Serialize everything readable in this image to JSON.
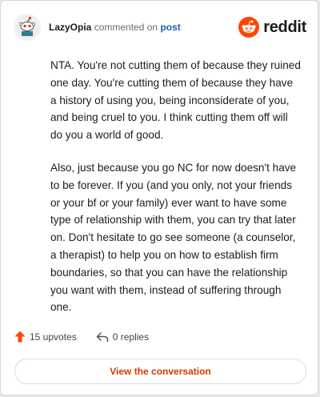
{
  "comment": {
    "username": "LazyOpia",
    "action_text": "commented on",
    "target_text": "post",
    "paragraphs": [
      "NTA. You're not cutting them of because they ruined one day. You're cutting them of because they have a history of using you, being inconsiderate of you, and being cruel to you. I think cutting them off will do you a world of good.",
      "Also, just because you go NC for now doesn't have to be forever. If you (and you only, not your friends or your bf or your family) ever want to have some type of relationship with them, you can try that later on. Don't hesitate to go see someone (a counselor, a therapist) to help you on how to establish firm boundaries, so that you can have the relationship you want with them, instead of suffering through one."
    ]
  },
  "brand": {
    "wordmark": "reddit",
    "icon": "reddit-snoo-icon",
    "color": "#ff4500"
  },
  "stats": {
    "upvotes_label": "15 upvotes",
    "replies_label": "0 replies",
    "upvote_icon": "upvote-arrow-icon",
    "reply_icon": "reply-arrow-icon",
    "upvote_color": "#ff4500"
  },
  "cta": {
    "label": "View the conversation",
    "color": "#d93a00"
  }
}
